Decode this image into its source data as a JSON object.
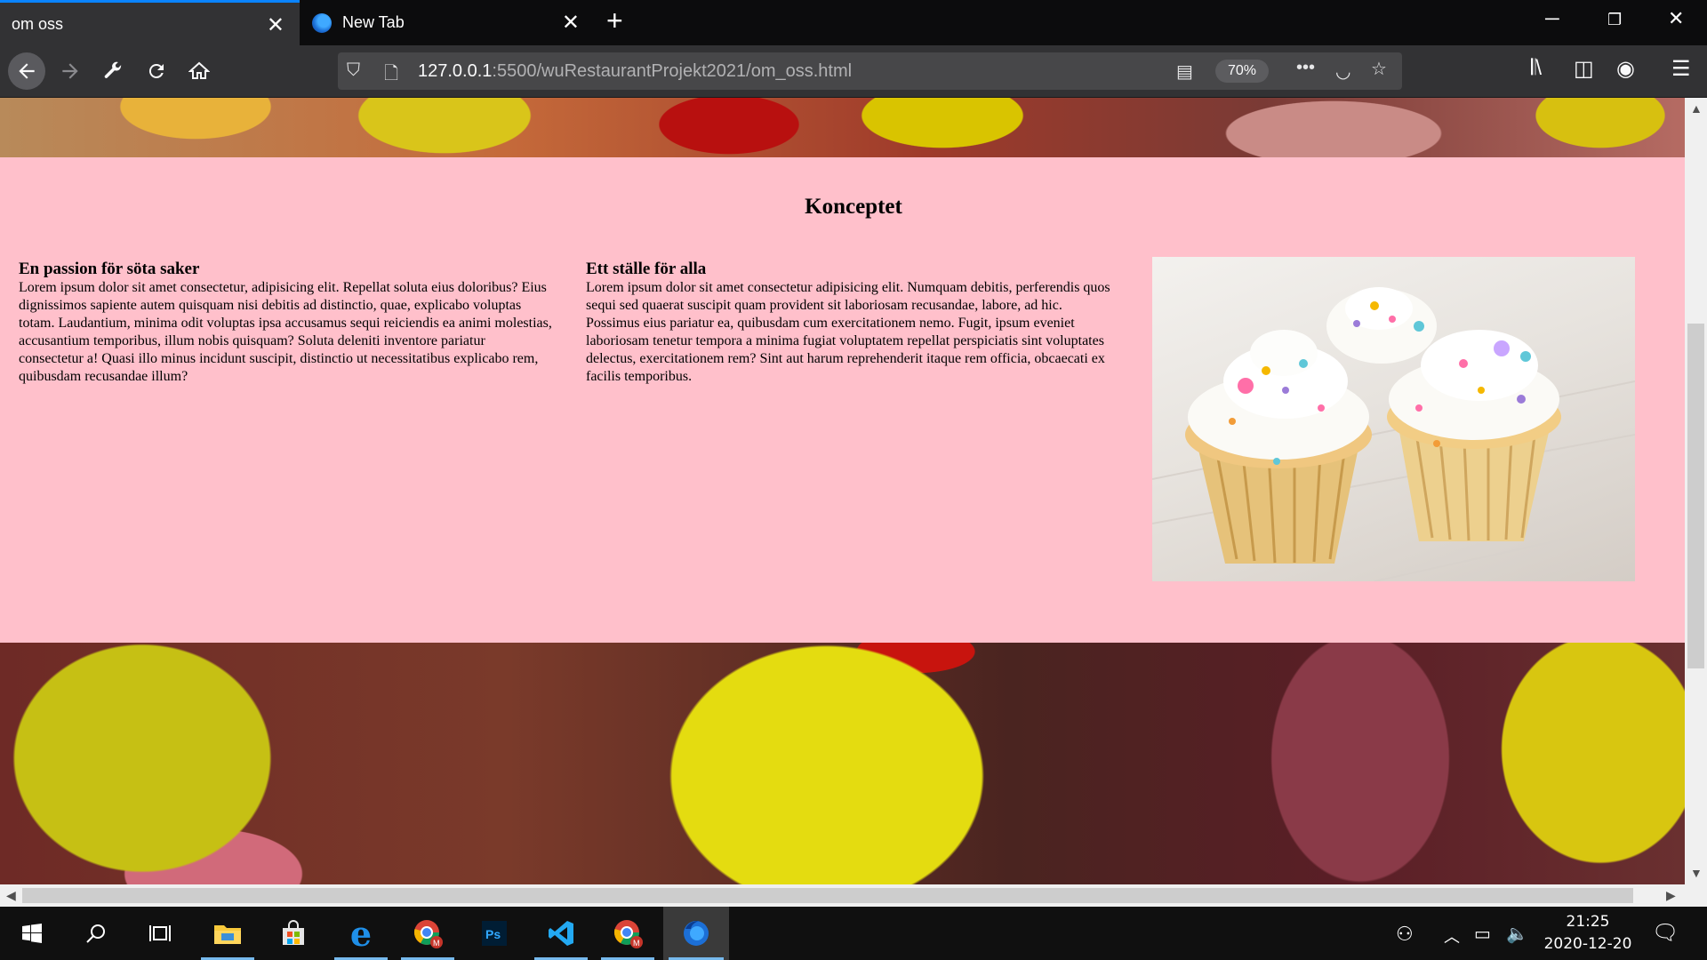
{
  "browser": {
    "tabs": [
      {
        "title": "om oss",
        "active": true
      },
      {
        "title": "New Tab",
        "active": false
      }
    ],
    "url": {
      "host": "127.0.0.1",
      "rest": ":5500/wuRestaurantProjekt2021/om_oss.html"
    },
    "zoom": "70%"
  },
  "page": {
    "heading": "Konceptet",
    "columns": [
      {
        "title": "En passion för söta saker",
        "text": "Lorem ipsum dolor sit amet consectetur, adipisicing elit. Repellat soluta eius doloribus? Eius dignissimos sapiente autem quisquam nisi debitis ad distinctio, quae, explicabo voluptas totam. Laudantium, minima odit voluptas ipsa accusamus sequi reiciendis ea animi molestias, accusantium temporibus, illum nobis quisquam? Soluta deleniti inventore pariatur consectetur a! Quasi illo minus incidunt suscipit, distinctio ut necessitatibus explicabo rem, quibusdam recusandae illum?"
      },
      {
        "title": "Ett ställe för alla",
        "text": "Lorem ipsum dolor sit amet consectetur adipisicing elit. Numquam debitis, perferendis quos sequi sed quaerat suscipit quam provident sit laboriosam recusandae, labore, ad hic. Possimus eius pariatur ea, quibusdam cum exercitationem nemo. Fugit, ipsum eveniet laboriosam tenetur tempora a minima fugiat voluptatem repellat perspiciatis sint voluptates delectus, exercitationem rem? Sint aut harum reprehenderit itaque rem officia, obcaecati ex facilis temporibus."
      }
    ],
    "background_color": "#ffc0cb"
  },
  "taskbar": {
    "time": "21:25",
    "date": "2020-12-20"
  }
}
